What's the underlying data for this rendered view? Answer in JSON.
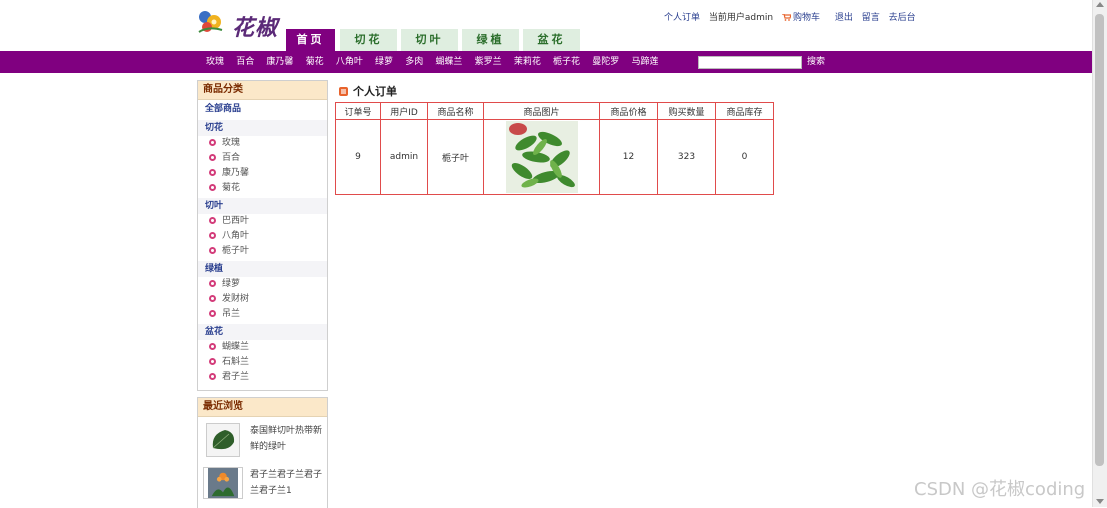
{
  "header": {
    "logo_text": "花椒",
    "links": {
      "my_orders": "个人订单",
      "current_user": "当前用户admin",
      "cart": "购物车",
      "logout": "退出",
      "message": "留言",
      "admin": "去后台"
    },
    "tabs": [
      "首页",
      "切花",
      "切叶",
      "绿植",
      "盆花"
    ]
  },
  "navbar": {
    "items": [
      "玫瑰",
      "百合",
      "康乃馨",
      "菊花",
      "八角叶",
      "绿萝",
      "多肉",
      "蝴蝶兰",
      "紫罗兰",
      "茉莉花",
      "栀子花",
      "曼陀罗",
      "马蹄莲"
    ],
    "search_value": "",
    "search_label": "搜索"
  },
  "sidebar": {
    "categories_title": "商品分类",
    "all_label": "全部商品",
    "groups": [
      {
        "title": "切花",
        "items": [
          "玫瑰",
          "百合",
          "康乃馨",
          "菊花"
        ]
      },
      {
        "title": "切叶",
        "items": [
          "巴西叶",
          "八角叶",
          "栀子叶"
        ]
      },
      {
        "title": "绿植",
        "items": [
          "绿萝",
          "发财树",
          "吊兰"
        ]
      },
      {
        "title": "盆花",
        "items": [
          "蝴蝶兰",
          "石斛兰",
          "君子兰"
        ]
      }
    ],
    "recent_title": "最近浏览",
    "recent": [
      {
        "text": "泰国鲜切叶热带新鲜的绿叶",
        "icon": "green-leaf-image"
      },
      {
        "text": "君子兰君子兰君子兰君子兰1",
        "icon": "clivia-plant-image"
      }
    ]
  },
  "main": {
    "title": "个人订单",
    "columns": [
      "订单号",
      "用户ID",
      "商品名称",
      "商品图片",
      "商品价格",
      "购买数量",
      "商品库存"
    ],
    "rows": [
      {
        "order_id": "9",
        "user_id": "admin",
        "name": "栀子叶",
        "image": "gardenia-leaves-image",
        "price": "12",
        "quantity": "323",
        "stock": "0"
      }
    ]
  },
  "watermark": "CSDN @花椒coding",
  "colors": {
    "brand_purple": "#800080",
    "tab_green": "#dfeee0",
    "table_border": "#e04b4b",
    "side_head": "#fbe8c9"
  }
}
